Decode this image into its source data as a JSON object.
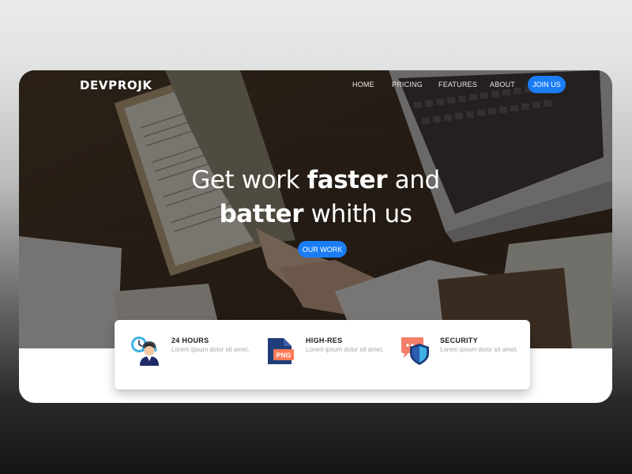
{
  "nav": {
    "logo": "DEVPROJK",
    "links": [
      "HOME",
      "PRICING",
      "FEATURES",
      "ABOUT"
    ],
    "cta": "JOIN US"
  },
  "hero": {
    "line1_prefix": "Get work ",
    "line1_bold": "faster",
    "line1_suffix": " and",
    "line2_bold": "batter",
    "line2_suffix": " whith us",
    "cta": "OUR WORK"
  },
  "features": [
    {
      "title": "24 HOURS",
      "desc": "Lorem ipsum dolor sit amet.",
      "icon": "clock-support-icon"
    },
    {
      "title": "HIGH-RES",
      "desc": "Lorem ipsum dolor sit amet.",
      "icon": "png-file-icon"
    },
    {
      "title": "SECURITY",
      "desc": "Lorem ipsum dolor sit amet.",
      "icon": "shield-chat-icon"
    }
  ],
  "icon_labels": {
    "png": "PNG"
  },
  "colors": {
    "accent": "#1a7df5",
    "hero_overlay": "#1e1812",
    "card": "#ffffff"
  }
}
